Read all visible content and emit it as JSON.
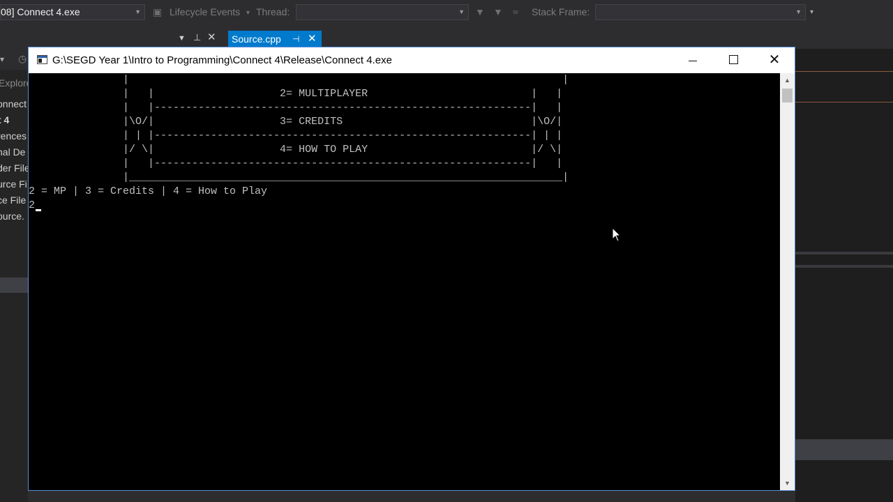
{
  "vs": {
    "process_combo": "08] Connect 4.exe",
    "lifecycle_label": "Lifecycle Events",
    "thread_label": "Thread:",
    "stackframe_label": "Stack Frame:",
    "doc_tab_label": "Source.cpp",
    "solution_items": [
      "Explore",
      "onnect",
      "t 4",
      "rences",
      "nal De",
      "der File",
      "urce Fi",
      "ce File",
      "ource."
    ]
  },
  "console": {
    "title": "G:\\SEGD Year 1\\Intro to Programming\\Connect 4\\Release\\Connect 4.exe",
    "lines": [
      "               |                                                                     |",
      "               |   |                    2= MULTIPLAYER                          |   |",
      "               |   |------------------------------------------------------------|   |",
      "               |\\O/|                    3= CREDITS                              |\\O/|",
      "               | | |------------------------------------------------------------| | |",
      "               |/ \\|                    4= HOW TO PLAY                          |/ \\|",
      "               |   |------------------------------------------------------------|   |",
      "               |_____________________________________________________________________|",
      "2 = MP | 3 = Credits | 4 = How to Play",
      "2"
    ]
  },
  "colors": {
    "vs_bg": "#2d2d30",
    "accent": "#007acc",
    "console_bg": "#000000",
    "console_text": "#c0c0c0"
  }
}
